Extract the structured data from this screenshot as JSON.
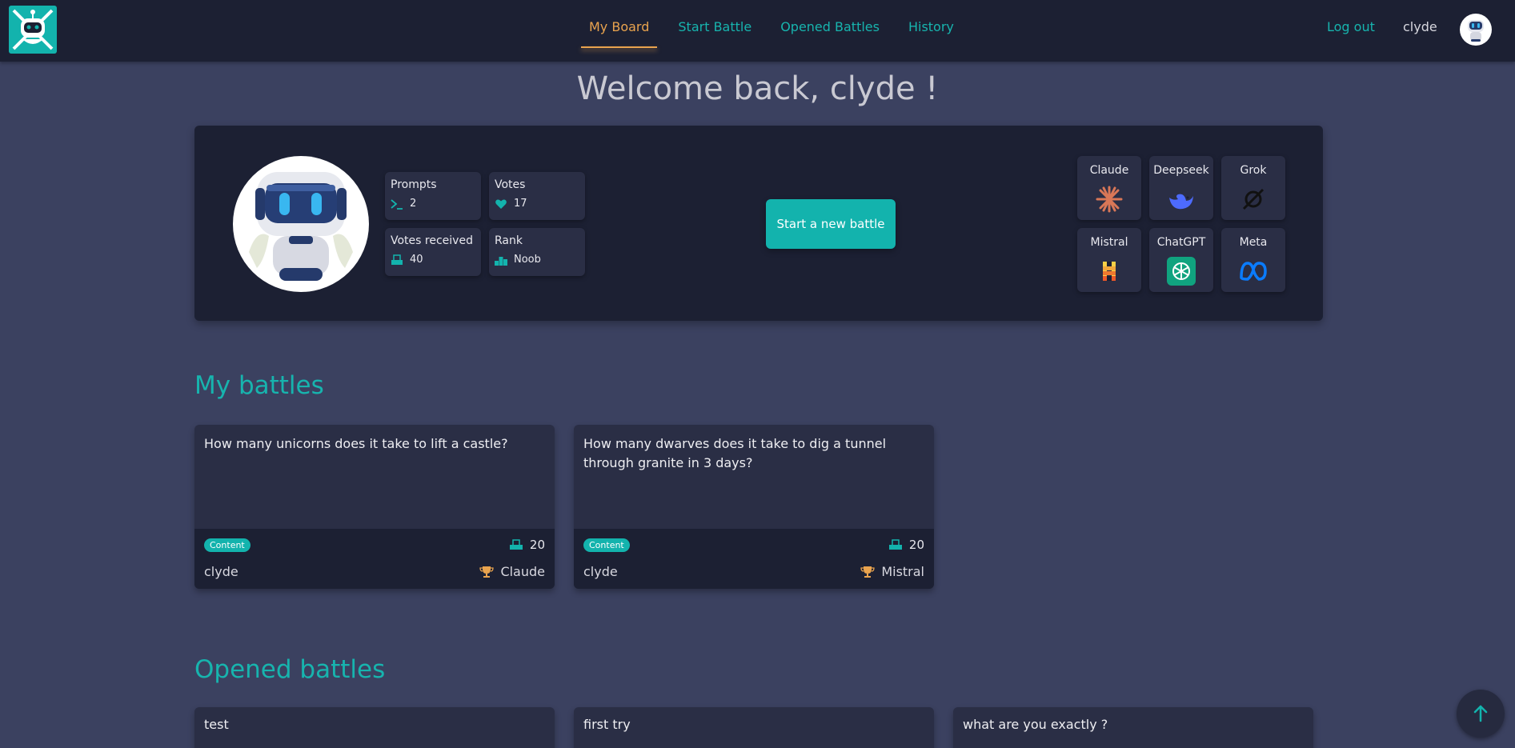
{
  "nav": {
    "links": [
      {
        "label": "My Board",
        "active": true
      },
      {
        "label": "Start Battle",
        "active": false
      },
      {
        "label": "Opened Battles",
        "active": false
      },
      {
        "label": "History",
        "active": false
      }
    ],
    "logout": "Log out",
    "username": "clyde",
    "logo_icon": "robot-swords-logo-icon",
    "avatar_icon": "robot-avatar-icon"
  },
  "welcome": "Welcome back, clyde !",
  "profile": {
    "avatar_icon": "robot-avatar-icon",
    "stats": {
      "prompts": {
        "label": "Prompts",
        "value": "2",
        "icon": "terminal-icon"
      },
      "votes": {
        "label": "Votes",
        "value": "17",
        "icon": "heart-icon"
      },
      "votes_received": {
        "label": "Votes received",
        "value": "40",
        "icon": "ballot-box-icon"
      },
      "rank": {
        "label": "Rank",
        "value": "Noob",
        "icon": "podium-icon"
      }
    },
    "start_button": "Start a new battle",
    "models": [
      {
        "name": "Claude",
        "icon": "claude-icon"
      },
      {
        "name": "Deepseek",
        "icon": "deepseek-whale-icon"
      },
      {
        "name": "Grok",
        "icon": "grok-icon"
      },
      {
        "name": "Mistral",
        "icon": "mistral-icon"
      },
      {
        "name": "ChatGPT",
        "icon": "chatgpt-icon"
      },
      {
        "name": "Meta",
        "icon": "meta-icon"
      }
    ]
  },
  "my_battles": {
    "title": "My battles",
    "items": [
      {
        "question": "How many unicorns does it take to lift a castle?",
        "badge": "Content",
        "votes": "20",
        "author": "clyde",
        "winner": "Claude"
      },
      {
        "question": "How many dwarves does it take to dig a tunnel through granite in 3 days?",
        "badge": "Content",
        "votes": "20",
        "author": "clyde",
        "winner": "Mistral"
      }
    ]
  },
  "opened_battles": {
    "title": "Opened battles",
    "items": [
      {
        "question": "test"
      },
      {
        "question": "first try"
      },
      {
        "question": "what are you exactly ?"
      }
    ]
  },
  "scroll_top_icon": "arrow-up-icon",
  "colors": {
    "background": "#3b4160",
    "panel": "#1c2033",
    "card": "#2a2e45",
    "accent": "#13b3ad",
    "active_nav": "#e9a34e"
  }
}
